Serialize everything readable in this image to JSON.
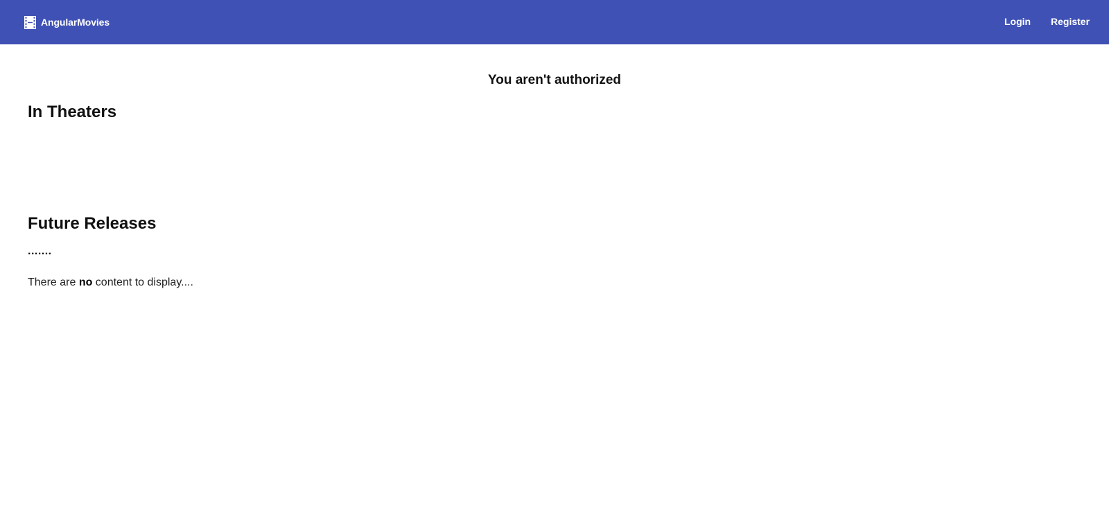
{
  "header": {
    "brand_icon": "film-icon",
    "brand_label": "AngularMovies",
    "login_label": "Login",
    "register_label": "Register",
    "background_color": "#3f51b5"
  },
  "main": {
    "auth_message": "You aren't authorized",
    "in_theaters_title": "In Theaters",
    "future_releases_title": "Future Releases",
    "loading_text": ".......",
    "empty_prefix": "There are ",
    "empty_strong": "no",
    "empty_suffix": " content to display...."
  }
}
